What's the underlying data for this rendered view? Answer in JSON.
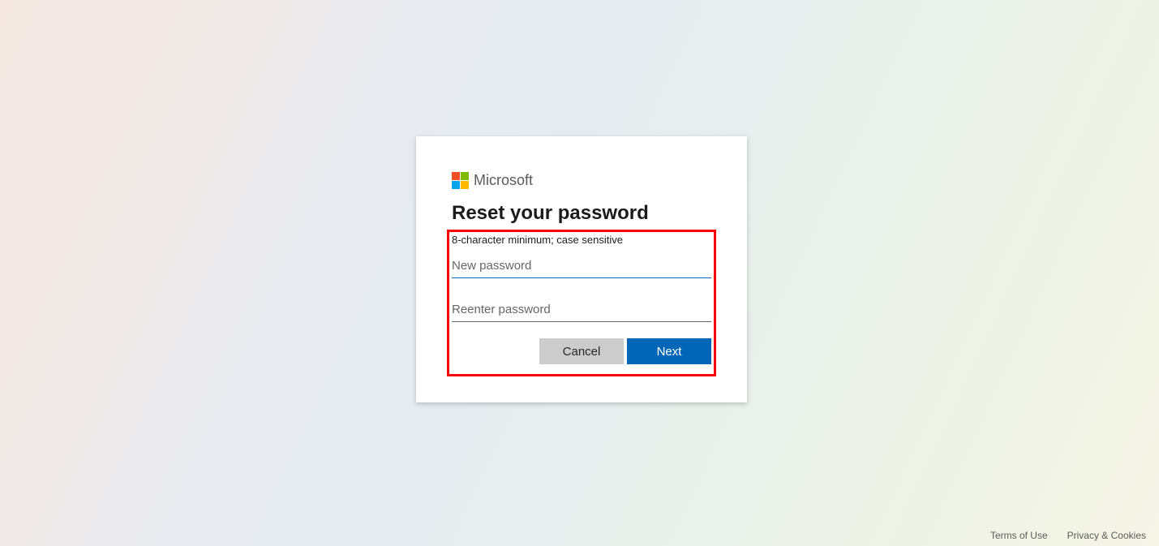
{
  "brand": "Microsoft",
  "title": "Reset your password",
  "hint": "8-character minimum; case sensitive",
  "fields": {
    "new_password": {
      "placeholder": "New password",
      "value": ""
    },
    "reenter_password": {
      "placeholder": "Reenter password",
      "value": ""
    }
  },
  "buttons": {
    "cancel": "Cancel",
    "next": "Next"
  },
  "footer": {
    "terms": "Terms of Use",
    "privacy": "Privacy & Cookies"
  }
}
